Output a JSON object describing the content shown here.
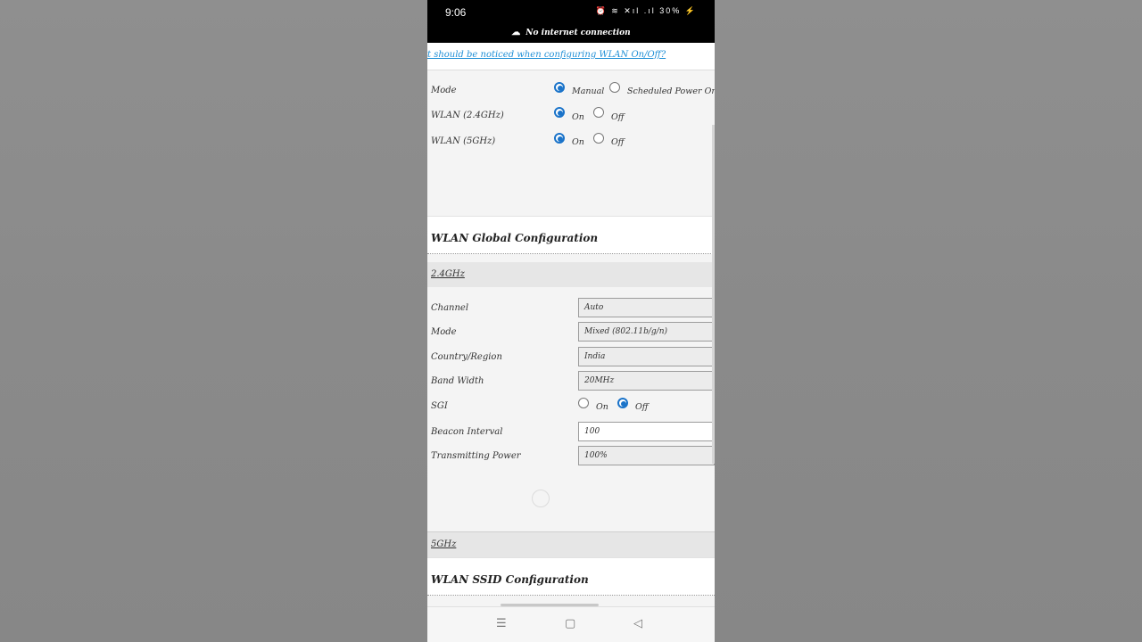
{
  "status_bar": {
    "time": "9:06",
    "icons": "⏰ ≋ ✕ıl .ıl 30% ⚡",
    "no_internet": "No internet connection",
    "no_internet_icon": "cloud-off-icon"
  },
  "help_link": "t should be noticed when configuring WLAN On/Off?",
  "wlan_switch": {
    "mode_label": "Mode",
    "mode_manual": "Manual",
    "mode_scheduled": "Scheduled Power On",
    "wlan24_label": "WLAN (2.4GHz)",
    "wlan5_label": "WLAN (5GHz)",
    "on": "On",
    "off": "Off"
  },
  "global_config": {
    "title": "WLAN Global Configuration",
    "band_24": "2.4GHz",
    "channel_label": "Channel",
    "channel_value": "Auto",
    "mode_label": "Mode",
    "mode_value": "Mixed (802.11b/g/n)",
    "country_label": "Country/Region",
    "country_value": "India",
    "bandwidth_label": "Band Width",
    "bandwidth_value": "20MHz",
    "sgi_label": "SGI",
    "sgi_on": "On",
    "sgi_off": "Off",
    "beacon_label": "Beacon Interval",
    "beacon_value": "100",
    "power_label": "Transmitting Power",
    "power_value": "100%",
    "band_5": "5GHz"
  },
  "ssid_config": {
    "title": "WLAN SSID Configuration"
  },
  "nav": {
    "recent": "☰",
    "home": "▢",
    "back": "◁"
  }
}
